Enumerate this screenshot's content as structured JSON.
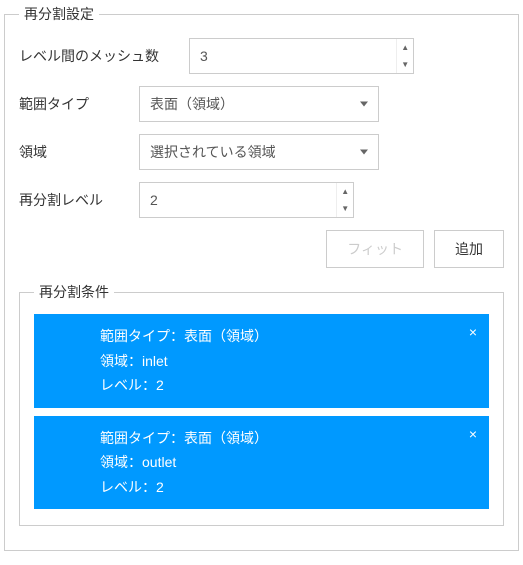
{
  "settings": {
    "legend": "再分割設定",
    "mesh_label": "レベル間のメッシュ数",
    "mesh_value": "3",
    "range_type_label": "範囲タイプ",
    "range_type_value": "表面（領域）",
    "region_label": "領域",
    "region_value": "選択されている領域",
    "level_label": "再分割レベル",
    "level_value": "2",
    "fit_label": "フィット",
    "add_label": "追加"
  },
  "conditions": {
    "legend": "再分割条件",
    "field_labels": {
      "range_type": "範囲タイプ：",
      "region": "領域：",
      "level": "レベル："
    },
    "items": [
      {
        "range_type": "表面（領域）",
        "region": "inlet",
        "level": "2"
      },
      {
        "range_type": "表面（領域）",
        "region": "outlet",
        "level": "2"
      }
    ]
  }
}
